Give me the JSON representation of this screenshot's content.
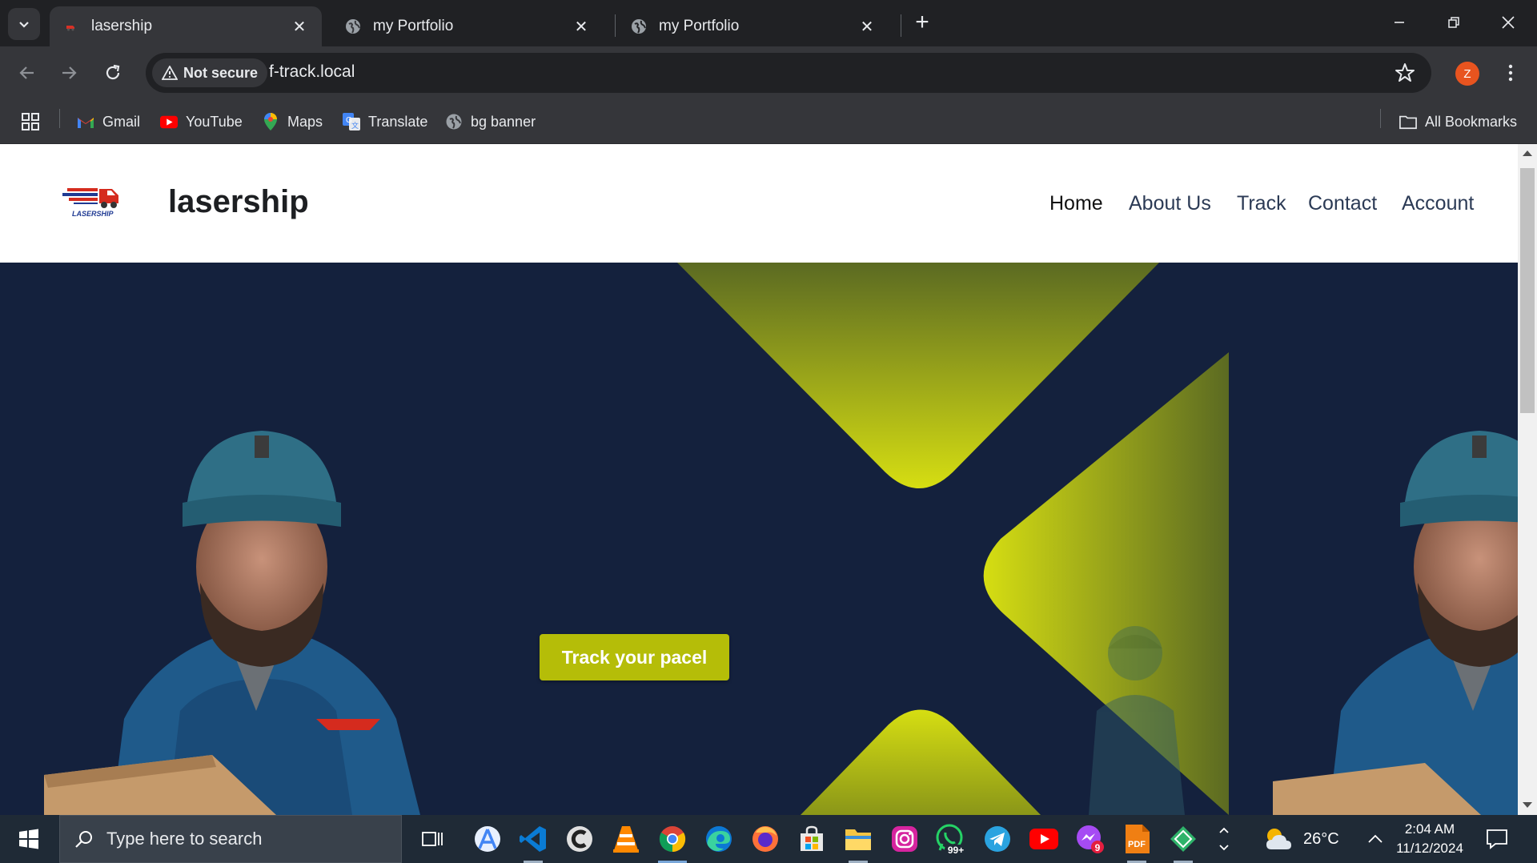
{
  "browser": {
    "tabs": [
      {
        "title": "lasership",
        "active": true
      },
      {
        "title": "my Portfolio",
        "active": false
      },
      {
        "title": "my Portfolio",
        "active": false
      }
    ],
    "security_chip": "Not secure",
    "url": "f-track.local",
    "profile_initial": "Z",
    "bookmarks": [
      {
        "label": "Gmail",
        "icon": "gmail-icon"
      },
      {
        "label": "YouTube",
        "icon": "youtube-icon"
      },
      {
        "label": "Maps",
        "icon": "maps-icon"
      },
      {
        "label": "Translate",
        "icon": "translate-icon"
      },
      {
        "label": "bg banner",
        "icon": "globe-icon"
      }
    ],
    "all_bookmarks": "All Bookmarks"
  },
  "site": {
    "brand": "lasership",
    "logo_text": "LASERSHIP",
    "nav": [
      "Home",
      "About Us",
      "Track",
      "Contact",
      "Account"
    ],
    "cta": "Track your pacel",
    "colors": {
      "hero_bg": "#14213d",
      "accent": "#b5bd08"
    }
  },
  "taskbar": {
    "search_placeholder": "Type here to search",
    "weather": "26°C",
    "time": "2:04 AM",
    "date": "11/12/2024",
    "whatsapp_badge": "99+",
    "messenger_badge": "9",
    "pdf_label": "PDF"
  }
}
